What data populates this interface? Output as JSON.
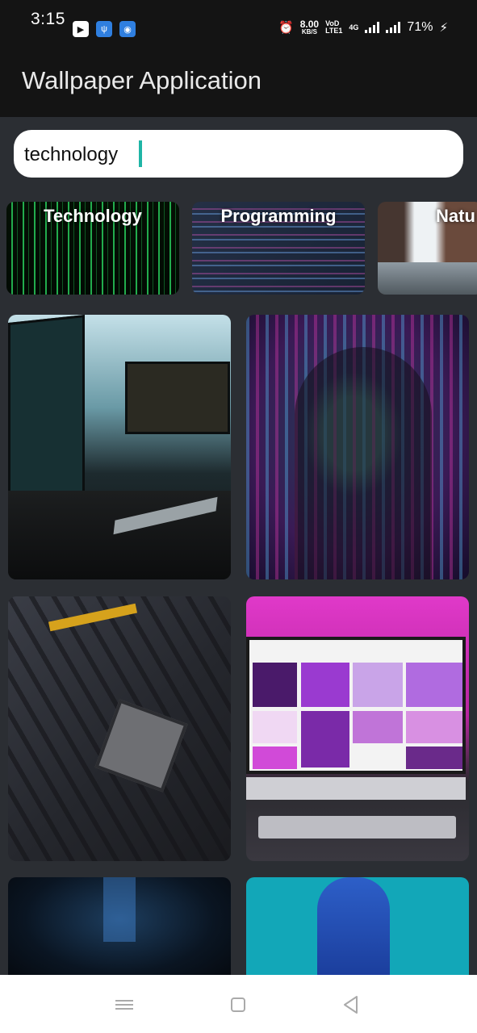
{
  "status_bar": {
    "time": "3:15",
    "speed_value": "8.00",
    "speed_unit": "KB/S",
    "volte_top": "VoD",
    "volte_bottom": "LTE1",
    "net_top": "4G",
    "battery": "71%",
    "icons": [
      "youtube-icon",
      "usb-icon",
      "android-icon",
      "alarm-icon",
      "signal-icon",
      "battery-charging-icon"
    ]
  },
  "app_bar": {
    "title": "Wallpaper Application"
  },
  "search": {
    "value": "technology"
  },
  "categories": [
    {
      "label": "Technology"
    },
    {
      "label": "Programming"
    },
    {
      "label": "Natu"
    }
  ],
  "nav_bar": {
    "icons": [
      "menu-icon",
      "home-icon",
      "back-icon"
    ]
  }
}
